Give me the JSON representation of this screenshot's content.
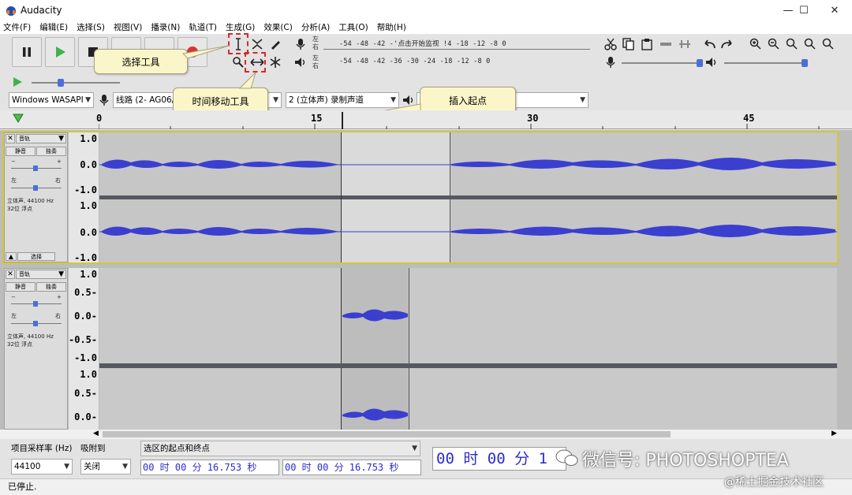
{
  "window": {
    "title": "Audacity",
    "minimize": "—",
    "maximize": "☐",
    "close": "✕"
  },
  "menu": [
    "文件(F)",
    "编辑(E)",
    "选择(S)",
    "视图(V)",
    "播录(N)",
    "轨道(T)",
    "生成(G)",
    "效果(C)",
    "分析(A)",
    "工具(O)",
    "帮助(H)"
  ],
  "meters": {
    "record_lr": [
      "左",
      "右"
    ],
    "play_lr": [
      "左",
      "右"
    ],
    "record_scale": "-54  -48  -42  -'点击开始监视 !4  -18  -12   -8    0",
    "play_scale": "-54  -48  -42  -36  -30  -24  -18  -12   -8    0"
  },
  "devices": {
    "host": "Windows WASAPI",
    "input": "线路 (2- AG06/A",
    "channels": "2 (立体声) 录制声道",
    "output": ""
  },
  "callouts": {
    "select_tool": "选择工具",
    "timeshift_tool": "时间移动工具",
    "insert_point": "插入起点"
  },
  "ruler": {
    "ticks": [
      "0",
      "15",
      "30",
      "45"
    ]
  },
  "tracks": [
    {
      "name": "音轨",
      "mute": "静音",
      "solo": "独奏",
      "gain_minus": "−",
      "gain_plus": "+",
      "pan_left": "左",
      "pan_right": "右",
      "info1": "立体声, 44100 Hz",
      "info2": "32位 浮点",
      "select": "选择",
      "ch1_labels": [
        "1.0",
        "0.0",
        "-1.0"
      ],
      "ch2_labels": [
        "1.0",
        "0.0",
        "-1.0"
      ]
    },
    {
      "name": "音轨",
      "mute": "静音",
      "solo": "独奏",
      "gain_minus": "−",
      "gain_plus": "+",
      "pan_left": "左",
      "pan_right": "右",
      "info1": "立体声, 44100 Hz",
      "info2": "32位 浮点",
      "ch1_labels": [
        "1.0",
        "0.5-",
        "0.0-",
        "-0.5-",
        "-1.0"
      ],
      "ch2_labels": [
        "1.0",
        "0.5-",
        "0.0-"
      ]
    }
  ],
  "bottom": {
    "rate_label": "项目采样率 (Hz)",
    "rate_value": "44100",
    "snap_label": "吸附到",
    "snap_value": "关闭",
    "sel_label": "选区的起点和终点",
    "sel_start": "00 时 00 分 16.753 秒",
    "sel_end": "00 时 00 分 16.753 秒",
    "big_time": "00 时 00 分 1"
  },
  "status": "已停止.",
  "watermark": {
    "wechat": "微信号: PHOTOSHOPTEA",
    "site": "@稀土掘金技术社区"
  },
  "colors": {
    "wave": "#3a3fd0",
    "selection_outline": "#e3d53a",
    "callout_bg": "#fbf6c9",
    "red_dash": "#d52a2a"
  }
}
